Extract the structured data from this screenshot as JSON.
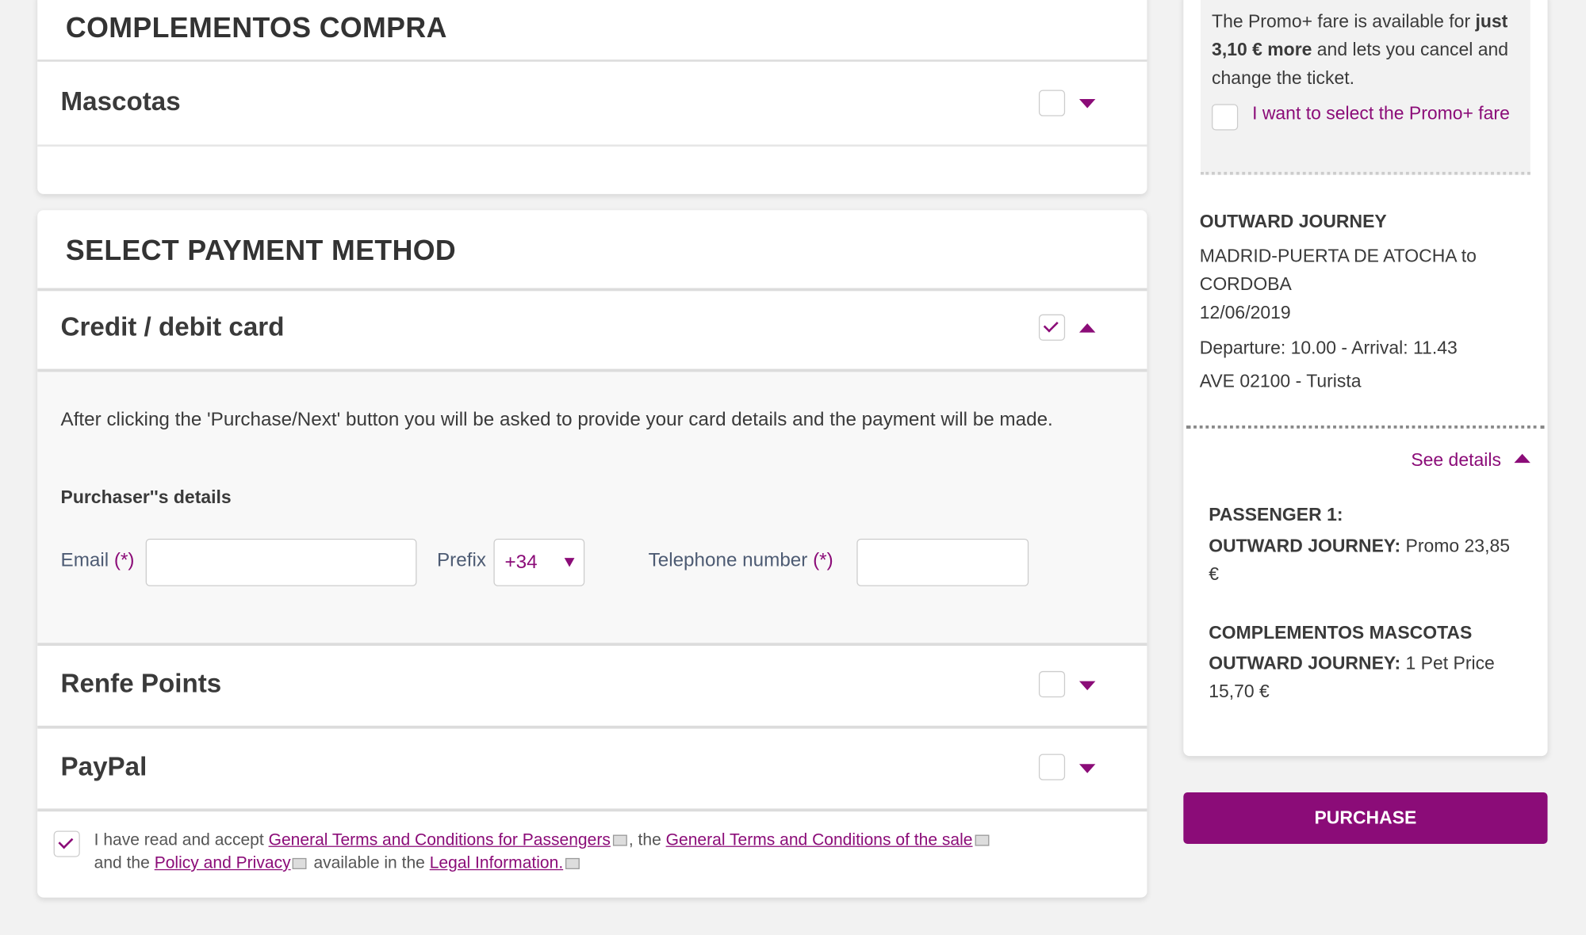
{
  "complementos": {
    "title": "COMPLEMENTOS COMPRA",
    "items": [
      {
        "label": "Mascotas",
        "checked": false,
        "expanded": false
      }
    ]
  },
  "payment": {
    "title": "SELECT PAYMENT METHOD",
    "methods": [
      {
        "label": "Credit / debit card",
        "checked": true,
        "expanded": true
      },
      {
        "label": "Renfe Points",
        "checked": false,
        "expanded": false
      },
      {
        "label": "PayPal",
        "checked": false,
        "expanded": false
      }
    ],
    "card_info": "After clicking the 'Purchase/Next' button you will be asked to provide your card details and the payment will be made.",
    "purchaser_title": "Purchaser''s details",
    "email_label": "Email",
    "required_mark": "(*)",
    "email_value": "",
    "prefix_label": "Prefix",
    "prefix_value": "+34",
    "phone_label": "Telephone number",
    "phone_value": ""
  },
  "terms": {
    "checked": true,
    "t1": "I have read and accept ",
    "link1": "General Terms and Conditions for Passengers",
    "t2": ", the ",
    "link2": "General Terms and Conditions of the sale",
    "t3": "and the ",
    "link3": "Policy and Privacy",
    "t4": " available in the ",
    "link4": "Legal Information."
  },
  "summary": {
    "promo_text_1": "The Promo+ fare is available for ",
    "promo_bold": "just 3,10 € more",
    "promo_text_2": " and lets you cancel and change the ticket.",
    "promo_checkbox_label": "I want to select the Promo+ fare",
    "journey_title": "OUTWARD JOURNEY",
    "route": "MADRID-PUERTA DE ATOCHA to CORDOBA",
    "date": "12/06/2019",
    "times": "Departure: 10.00 - Arrival: 11.43",
    "train": "AVE 02100 - Turista",
    "see_details": "See details",
    "passenger_title": "PASSENGER 1:",
    "passenger_journey_label": "OUTWARD JOURNEY:",
    "passenger_journey_value": " Promo 23,85 €",
    "complement_title": "COMPLEMENTOS MASCOTAS",
    "complement_journey_label": "OUTWARD JOURNEY:",
    "complement_journey_value": " 1 Pet Price 15,70 €",
    "purchase_button": "PURCHASE"
  },
  "colors": {
    "accent": "#8b0c78",
    "background": "#f2f2f2"
  }
}
